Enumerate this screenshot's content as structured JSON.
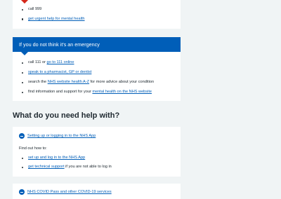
{
  "emergency": {
    "items": [
      {
        "text": "call 999",
        "link": ""
      },
      {
        "link": "get urgent help for mental health",
        "text": ""
      }
    ]
  },
  "not_emergency": {
    "heading": "If you do not think it's an emergency",
    "items": [
      {
        "before": "call 111 or ",
        "link": "go to 111 online",
        "after": ""
      },
      {
        "before": "",
        "link": "speak to a pharmacist, GP or dentist",
        "after": ""
      },
      {
        "before": "search the ",
        "link": "NHS website health A-Z",
        "after": " for more advice about your condition"
      },
      {
        "before": "find information and support for your ",
        "link": "mental health on the NHS website",
        "after": ""
      }
    ]
  },
  "help": {
    "title": "What do you need help with?",
    "sections": [
      {
        "summary": "Setting up or logging in to the NHS App",
        "intro": "Find out how to:",
        "items": [
          {
            "before": "",
            "link": "set up and log in to the NHS App",
            "after": ""
          },
          {
            "before": "",
            "link": "get technical support",
            "after": " if you are not able to log in"
          }
        ]
      },
      {
        "summary": "NHS COVID Pass and other COVID-19 services"
      }
    ]
  },
  "colors": {
    "nhs_blue": "#005eb8",
    "emergency_red": "#d5281b",
    "background": "#f0f4f5",
    "text": "#212b32"
  }
}
